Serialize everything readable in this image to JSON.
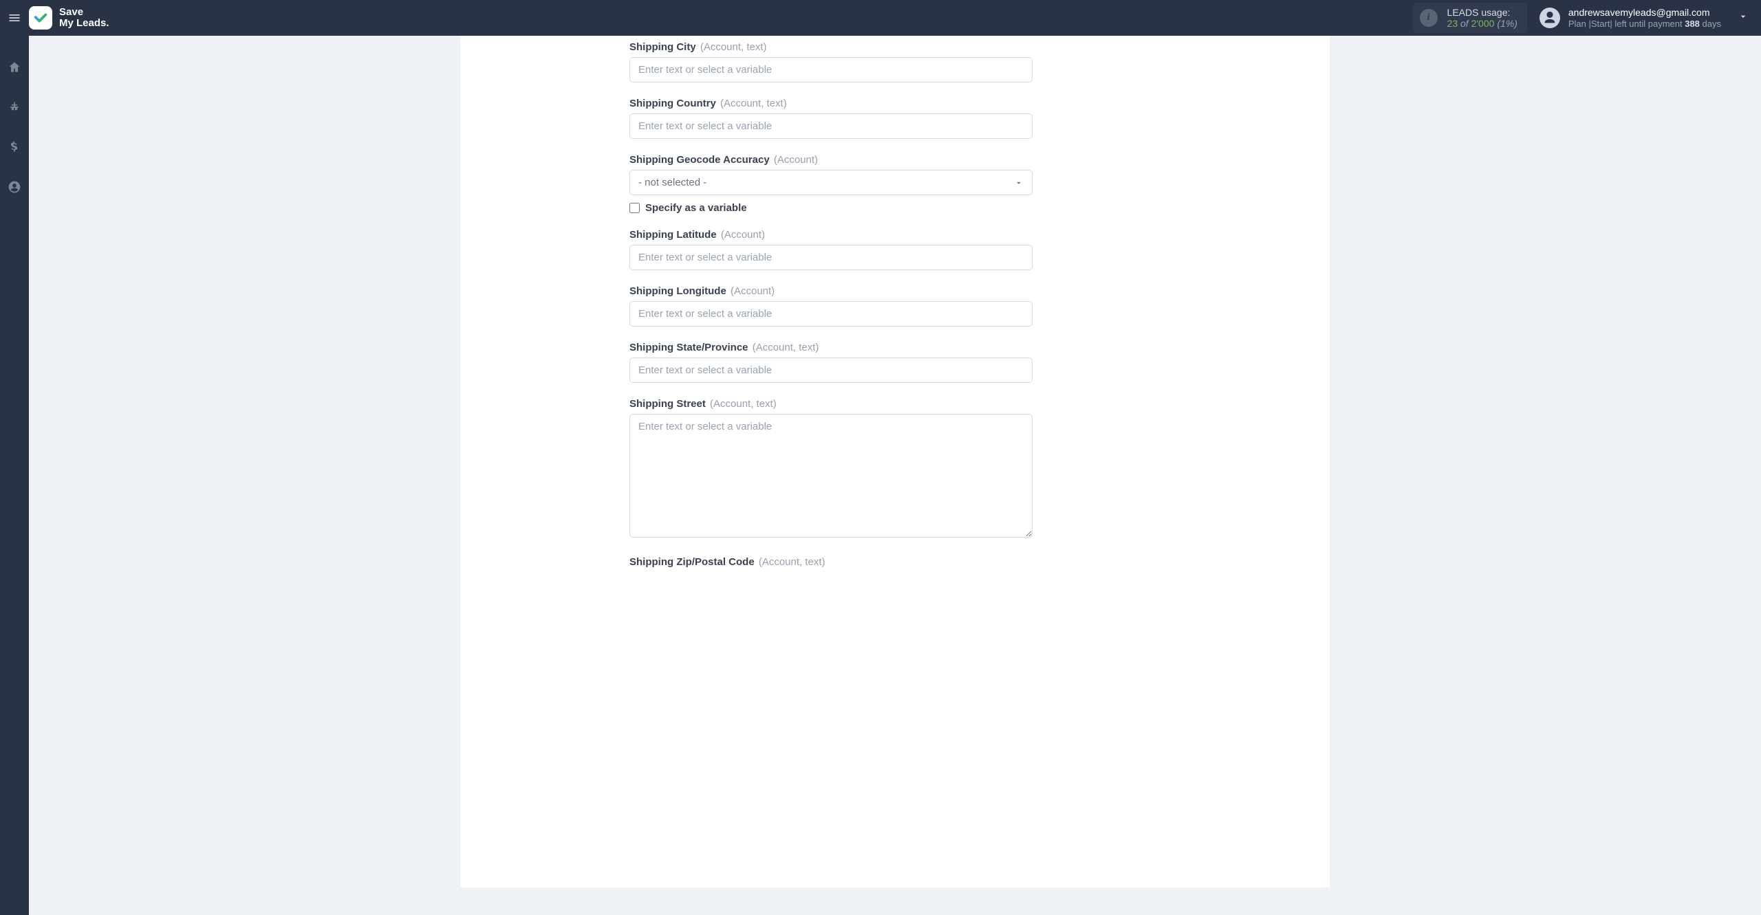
{
  "brand": {
    "line1": "Save",
    "line2": "My Leads."
  },
  "header": {
    "usage": {
      "label": "LEADS usage:",
      "used": "23",
      "of_word": "of",
      "limit": "2'000",
      "pct": "(1%)"
    },
    "user": {
      "email": "andrewsavemyleads@gmail.com",
      "plan_prefix": "Plan |Start| left until payment ",
      "plan_days": "388",
      "plan_suffix": " days"
    }
  },
  "fields": {
    "shipping_city": {
      "label": "Shipping City",
      "hint": "(Account, text)",
      "placeholder": "Enter text or select a variable"
    },
    "shipping_country": {
      "label": "Shipping Country",
      "hint": "(Account, text)",
      "placeholder": "Enter text or select a variable"
    },
    "shipping_geocode": {
      "label": "Shipping Geocode Accuracy",
      "hint": "(Account)",
      "selected": "- not selected -",
      "checkbox_label": "Specify as a variable"
    },
    "shipping_latitude": {
      "label": "Shipping Latitude",
      "hint": "(Account)",
      "placeholder": "Enter text or select a variable"
    },
    "shipping_longitude": {
      "label": "Shipping Longitude",
      "hint": "(Account)",
      "placeholder": "Enter text or select a variable"
    },
    "shipping_state": {
      "label": "Shipping State/Province",
      "hint": "(Account, text)",
      "placeholder": "Enter text or select a variable"
    },
    "shipping_street": {
      "label": "Shipping Street",
      "hint": "(Account, text)",
      "placeholder": "Enter text or select a variable"
    },
    "shipping_zip": {
      "label": "Shipping Zip/Postal Code",
      "hint": "(Account, text)"
    }
  }
}
